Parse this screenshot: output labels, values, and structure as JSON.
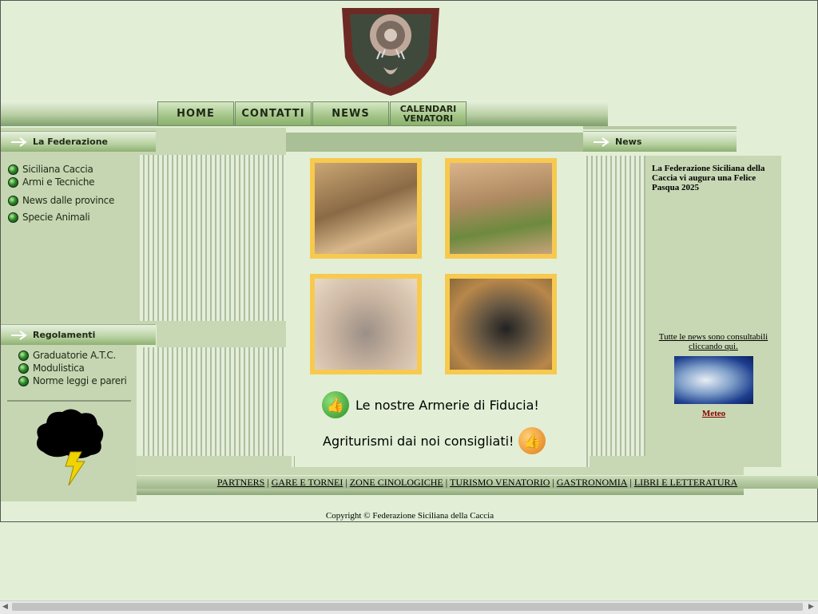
{
  "nav": {
    "home": "HOME",
    "contatti": "CONTATTI",
    "news": "NEWS",
    "calendari": "CALENDARI\nVENATORI"
  },
  "left": {
    "header_federazione": "La Federazione",
    "federazione_items": [
      "Siciliana Caccia",
      "Armi e Tecniche",
      "News dalle province",
      "Specie Animali"
    ],
    "header_regolamenti": "Regolamenti",
    "regolamenti_items": [
      "Graduatorie A.T.C.",
      "Modulistica",
      "Norme leggi e pareri"
    ]
  },
  "center": {
    "promo_armerie": "Le nostre Armerie di Fiducia!",
    "promo_agriturismi": "Agriturismi dai noi consigliati!"
  },
  "right": {
    "header_news": "News",
    "news_text": "La Federazione Siciliana della Caccia vi augura una Felice Pasqua 2025",
    "all_news_link": "Tutte le news sono consultabili cliccando qui.",
    "meteo_link": "Meteo"
  },
  "footer": {
    "links": [
      "PARTNERS",
      "GARE E TORNEI",
      "ZONE CINOLOGICHE",
      "TURISMO VENATORIO",
      "GASTRONOMIA",
      "LIBRI E LETTERATURA"
    ],
    "copyright": "Copyright © Federazione Siciliana della Caccia"
  },
  "colors": {
    "page_bg": "#e2efd6",
    "panel_bg": "#c6d6b2",
    "photo_frame": "#f7c94f",
    "meteo_link": "#8b0000"
  }
}
